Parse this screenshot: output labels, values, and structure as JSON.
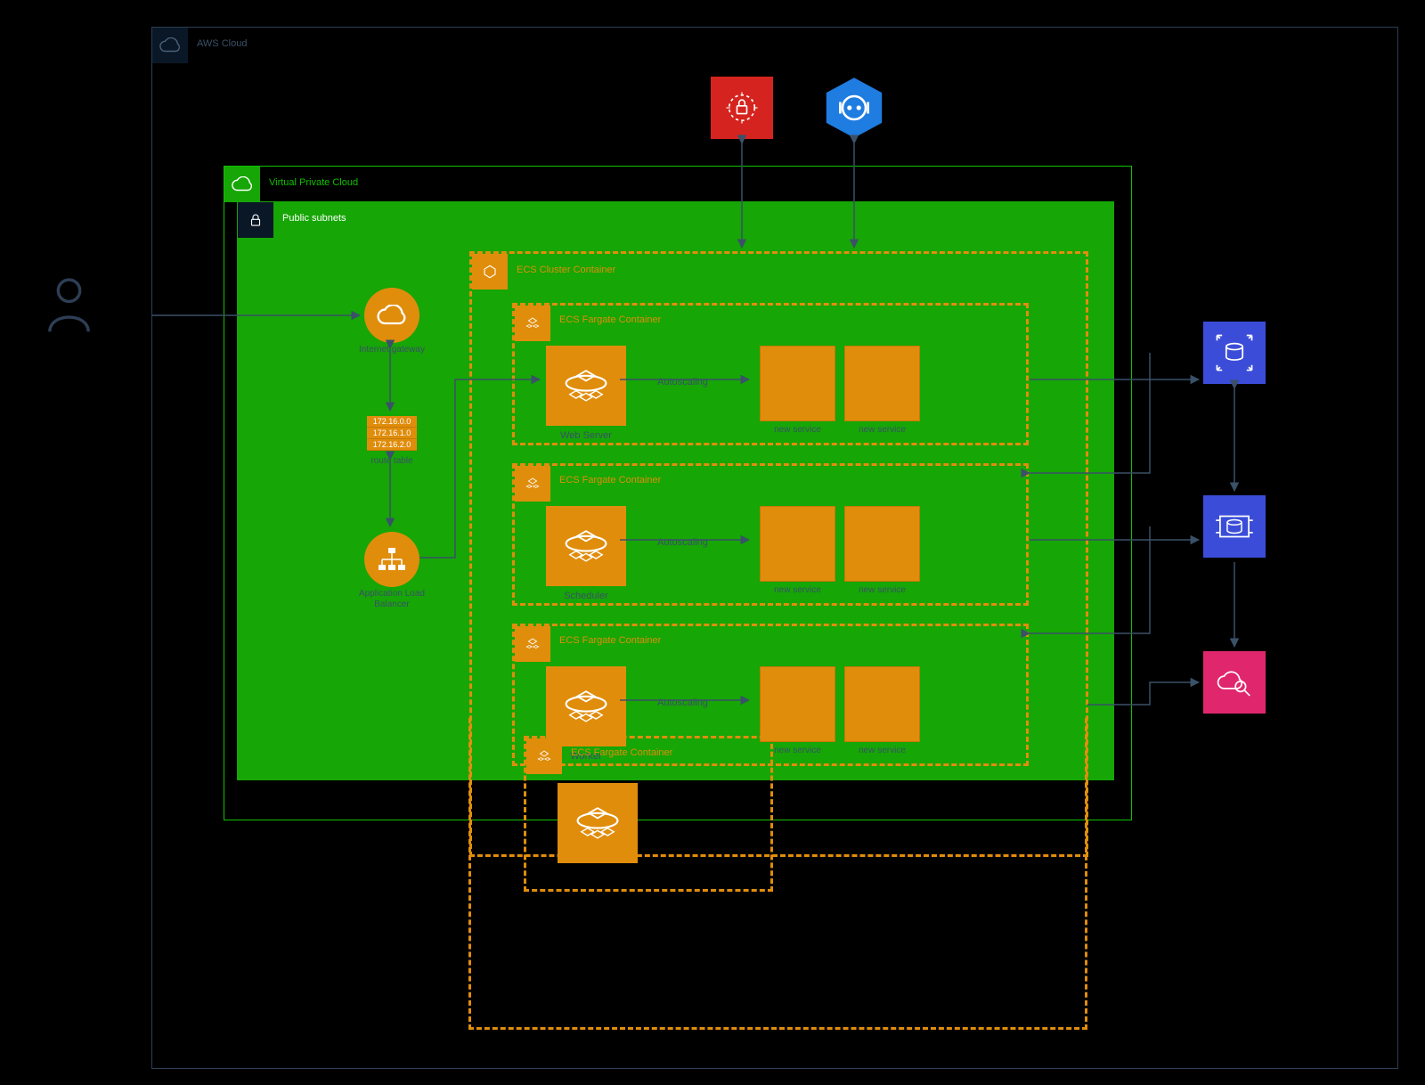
{
  "colors": {
    "orange": "#e08d0c",
    "green_fill": "#16a605",
    "green_stroke": "#10c100",
    "red": "#d5241f",
    "blue": "#1f7ce0",
    "navy": "#3b4dd8",
    "pink": "#e0276e",
    "stroke_grey": "#3a5168"
  },
  "aws_cloud": {
    "label": "AWS Cloud"
  },
  "vpc": {
    "label": "Virtual Private Cloud"
  },
  "subnet": {
    "label": "Public subnets"
  },
  "ecs_cluster": {
    "label": "ECS Cluster Container"
  },
  "fargate": [
    {
      "label": "ECS Fargate Container",
      "node": "Web Server",
      "auto": "Autoscaling",
      "svc": "new service"
    },
    {
      "label": "ECS Fargate Container",
      "node": "Scheduler",
      "auto": "Autoscaling",
      "svc": "new service"
    },
    {
      "label": "ECS Fargate Container",
      "node": "Worker",
      "auto": "Autoscaling",
      "svc": "new service"
    }
  ],
  "fargate_ext": {
    "label": "ECS Fargate Container"
  },
  "igw": {
    "label": "Internet gateway"
  },
  "route_table": {
    "rows": [
      "172.16.0.0",
      "172.16.1.0",
      "172.16.2.0"
    ],
    "label": "route table"
  },
  "alb": {
    "label": "Application Load Balancer"
  },
  "user_icon": "user-icon",
  "external_services": {
    "red": "inspector-icon",
    "blue_hex": "app-config-icon",
    "navy1": "rds-autoscale-icon",
    "navy2": "rds-cache-icon",
    "pink": "cloudwatch-icon"
  }
}
